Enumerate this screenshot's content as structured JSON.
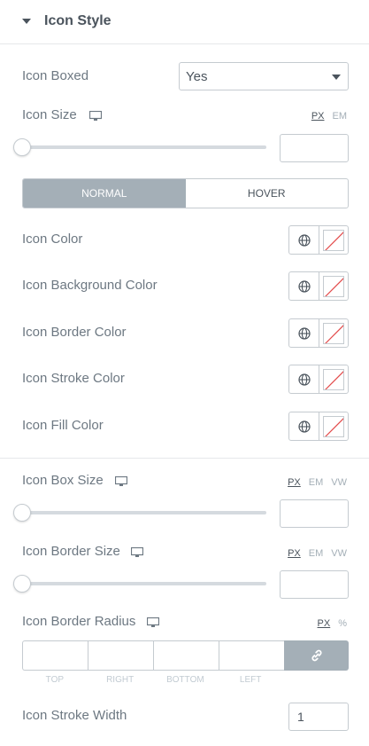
{
  "section": {
    "title": "Icon Style"
  },
  "icon_boxed": {
    "label": "Icon Boxed",
    "value": "Yes"
  },
  "icon_size": {
    "label": "Icon Size",
    "units": [
      "PX",
      "EM"
    ],
    "active_unit": "PX",
    "value": ""
  },
  "state_tabs": [
    {
      "label": "NORMAL",
      "active": true
    },
    {
      "label": "HOVER",
      "active": false
    }
  ],
  "colors": [
    {
      "label": "Icon Color"
    },
    {
      "label": "Icon Background Color"
    },
    {
      "label": "Icon Border Color"
    },
    {
      "label": "Icon Stroke Color"
    },
    {
      "label": "Icon Fill Color"
    }
  ],
  "icon_box_size": {
    "label": "Icon Box Size",
    "units": [
      "PX",
      "EM",
      "VW"
    ],
    "active_unit": "PX",
    "value": ""
  },
  "icon_border_size": {
    "label": "Icon Border Size",
    "units": [
      "PX",
      "EM",
      "VW"
    ],
    "active_unit": "PX",
    "value": ""
  },
  "icon_border_radius": {
    "label": "Icon Border Radius",
    "units": [
      "PX",
      "%"
    ],
    "active_unit": "PX",
    "fields": [
      "TOP",
      "RIGHT",
      "BOTTOM",
      "LEFT"
    ]
  },
  "icon_stroke_width": {
    "label": "Icon Stroke Width",
    "value": "1"
  },
  "icons": {
    "caret": "caret-down-icon",
    "responsive": "desktop-monitor-icon",
    "global": "globe-icon",
    "clear_color": "no-color-swatch",
    "link": "link-icon"
  },
  "theme": {
    "accent": "#a4afb7",
    "border": "#c5cbd0",
    "text": "#6d7882",
    "heading": "#4b545d",
    "no_color_line": "#e34b4b"
  }
}
